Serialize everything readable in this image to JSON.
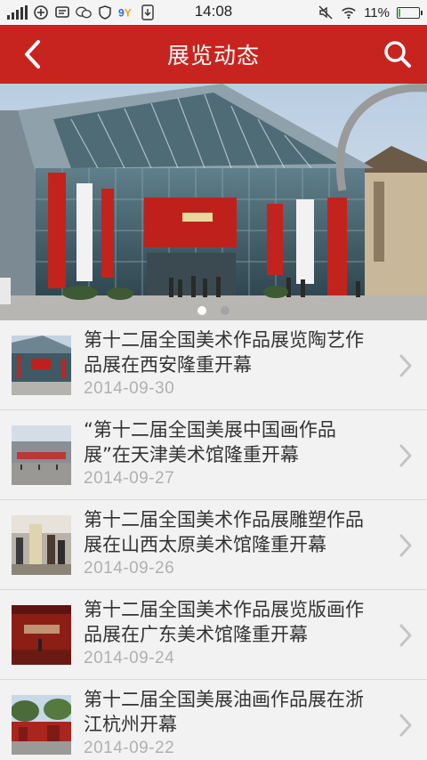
{
  "status_bar": {
    "time": "14:08",
    "battery_percent": "11%",
    "battery_level": 0.11,
    "battery_color": "#3bb54a"
  },
  "header": {
    "title": "展览动态",
    "back_icon": "back-arrow-icon",
    "search_icon": "search-icon",
    "color": "#c8241f"
  },
  "banner": {
    "slide_count": 2,
    "active_index": 0
  },
  "news": [
    {
      "title": "第十二届全国美术作品展览陶艺作品展在西安隆重开幕",
      "date": "2014-09-30"
    },
    {
      "title": "“第十二届全国美展中国画作品展”在天津美术馆隆重开幕",
      "date": "2014-09-27"
    },
    {
      "title": "第十二届全国美术作品展雕塑作品展在山西太原美术馆隆重开幕",
      "date": "2014-09-26"
    },
    {
      "title": "第十二届全国美术作品展览版画作品展在广东美术馆隆重开幕",
      "date": "2014-09-24"
    },
    {
      "title": "第十二届全国美展油画作品展在浙江杭州开幕",
      "date": "2014-09-22"
    }
  ]
}
